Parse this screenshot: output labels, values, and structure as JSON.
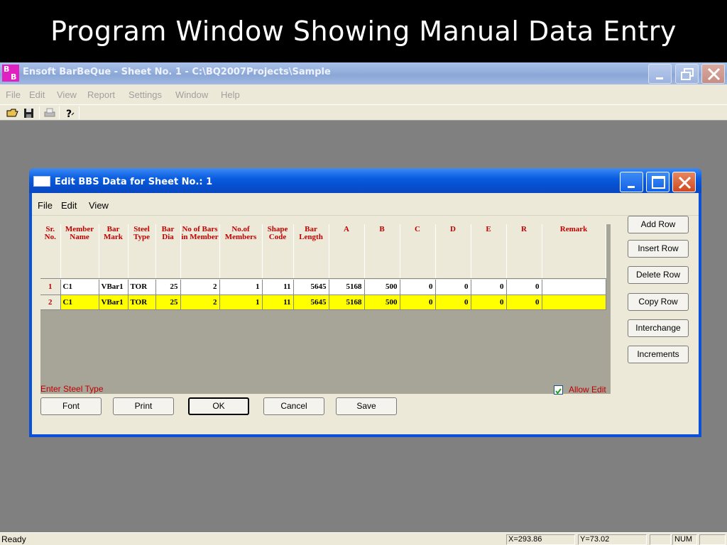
{
  "slide": {
    "title": "Program Window Showing Manual Data Entry"
  },
  "app": {
    "title": "Ensoft BarBeQue - Sheet No. 1 - C:\\BQ2007Projects\\Sample",
    "icon_letters": [
      "B",
      "B"
    ],
    "menu": [
      "File",
      "Edit",
      "View",
      "Report",
      "Settings",
      "Window",
      "Help"
    ],
    "toolbar": [
      "open-icon",
      "save-icon",
      "print-icon",
      "help-icon"
    ],
    "status": {
      "text": "Ready",
      "x": "X=293.86",
      "y": "Y=73.02",
      "num": "NUM"
    }
  },
  "dialog": {
    "title": "Edit BBS Data for Sheet No.: 1",
    "menu": [
      "File",
      "Edit",
      "View"
    ],
    "columns": [
      "Sr. No.",
      "Member Name",
      "Bar Mark",
      "Steel Type",
      "Bar Dia",
      "No of Bars in Member",
      "No.of Members",
      "Shape Code",
      "Bar Length",
      "A",
      "B",
      "C",
      "D",
      "E",
      "R",
      "Remark"
    ],
    "rows": [
      [
        "1",
        "C1",
        "VBar1",
        "TOR",
        "25",
        "2",
        "1",
        "11",
        "5645",
        "5168",
        "500",
        "0",
        "0",
        "0",
        "0",
        ""
      ],
      [
        "2",
        "C1",
        "VBar1",
        "TOR",
        "25",
        "2",
        "1",
        "11",
        "5645",
        "5168",
        "500",
        "0",
        "0",
        "0",
        "0",
        ""
      ]
    ],
    "side_buttons": [
      "Add Row",
      "Insert Row",
      "Delete Row",
      "Copy Row",
      "Interchange",
      "Increments"
    ],
    "bottom_buttons": [
      "Font",
      "Print",
      "OK",
      "Cancel",
      "Save"
    ],
    "hint": "Enter Steel Type",
    "allow_edit": {
      "label": "Allow Edit",
      "checked": true
    }
  },
  "colors": {
    "header_text": "#c00000",
    "selected_row": "#ffff00",
    "xp_blue": "#0a50d8"
  }
}
